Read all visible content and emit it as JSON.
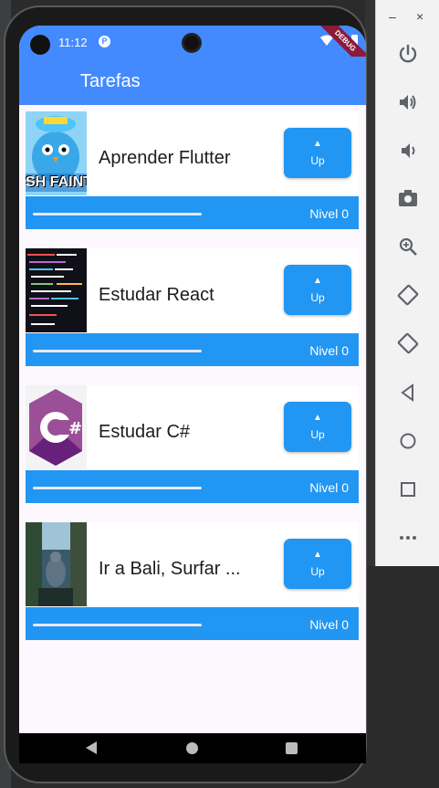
{
  "status_bar": {
    "time": "11:12",
    "debug_label": "DEBUG"
  },
  "app_bar": {
    "title": "Tarefas"
  },
  "tasks": [
    {
      "name": "Aprender Flutter",
      "button_label": "Up",
      "level_label": "Nivel 0",
      "progress": 0.0,
      "thumb_text": "SH FAINT"
    },
    {
      "name": "Estudar React",
      "button_label": "Up",
      "level_label": "Nivel 0",
      "progress": 0.0
    },
    {
      "name": "Estudar C#",
      "button_label": "Up",
      "level_label": "Nivel 0",
      "progress": 0.0
    },
    {
      "name": "Ir a Bali, Surfar ...",
      "button_label": "Up",
      "level_label": "Nivel 0",
      "progress": 0.0
    }
  ],
  "emulator_panel": {
    "minimize": "–",
    "close": "×"
  },
  "colors": {
    "primary": "#448aff",
    "button": "#2196f3",
    "nav": "#000000"
  }
}
